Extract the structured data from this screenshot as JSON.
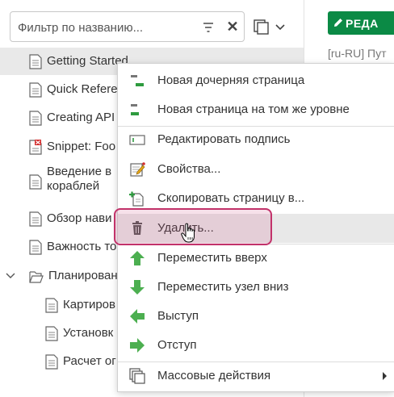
{
  "filter": {
    "placeholder": "Фильтр по названию..."
  },
  "editor": {
    "edit_label": "РЕДА",
    "title_fragment": "[ru-RU] Пут"
  },
  "tree": [
    {
      "label": "Getting Started",
      "selected": true
    },
    {
      "label": "Quick Refere"
    },
    {
      "label": "Creating API"
    },
    {
      "label": "Snippet: Foo"
    },
    {
      "label": "Введение в",
      "label2": "кораблей"
    },
    {
      "label": "Обзор нави"
    },
    {
      "label": "Важность то"
    },
    {
      "label": "Планирован",
      "expanded": true
    },
    {
      "label": "Картиров"
    },
    {
      "label": "Установк"
    },
    {
      "label": "Расчет ог"
    }
  ],
  "context_menu": {
    "items": [
      {
        "label": "Новая дочерняя страница",
        "icon": "new-child-page-icon"
      },
      {
        "label": "Новая страница на том же уровне",
        "icon": "new-sibling-page-icon"
      },
      {
        "label": "Редактировать подпись",
        "icon": "edit-caption-icon"
      },
      {
        "label": "Свойства...",
        "icon": "properties-icon"
      },
      {
        "label": "Скопировать страницу в...",
        "icon": "copy-page-icon"
      },
      {
        "label": "Удалить...",
        "icon": "trash-icon"
      },
      {
        "label": "Переместить вверх",
        "icon": "arrow-up-icon"
      },
      {
        "label": "Переместить узел вниз",
        "icon": "arrow-down-icon"
      },
      {
        "label": "Выступ",
        "icon": "arrow-left-icon"
      },
      {
        "label": "Отступ",
        "icon": "arrow-right-icon"
      },
      {
        "label": "Массовые действия",
        "icon": "bulk-actions-icon"
      }
    ]
  },
  "colors": {
    "accent_green": "#0b8a45",
    "icon_green": "#4caf50",
    "highlight": "#c2326a"
  },
  "blue_char": "("
}
